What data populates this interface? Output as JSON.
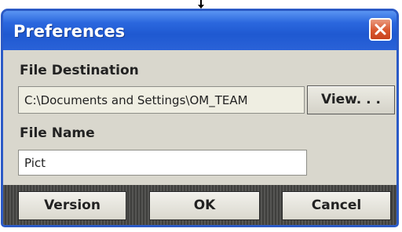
{
  "dialog": {
    "title": "Preferences",
    "close_icon": "close-x-icon"
  },
  "destination": {
    "label": "File Destination",
    "path_value": "C:\\Documents and Settings\\OM_TEAM",
    "view_button_label": "View. . ."
  },
  "file_name": {
    "label": "File Name",
    "value": "Pict"
  },
  "footer": {
    "version_label": "Version",
    "ok_label": "OK",
    "cancel_label": "Cancel"
  },
  "colors": {
    "title_bar": "#2b67de",
    "dialog_body": "#d9d7cd",
    "close_button": "#d9572e",
    "footer_bar": "#4a4a48"
  }
}
